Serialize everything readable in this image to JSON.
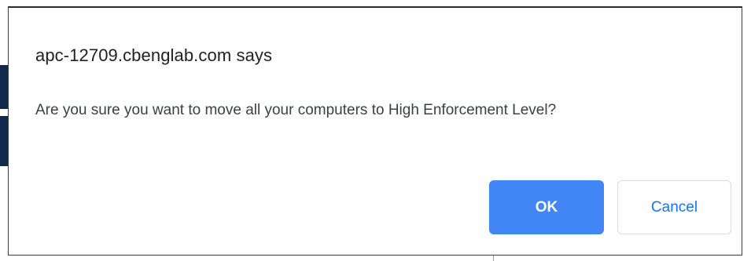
{
  "dialog": {
    "title": "apc-12709.cbenglab.com says",
    "message": "Are you sure you want to move all your computers to High Enforcement Level?",
    "ok_label": "OK",
    "cancel_label": "Cancel"
  },
  "colors": {
    "ok_button_bg": "#4285f4",
    "cancel_text": "#1a73e8",
    "title_text": "#202124",
    "message_text": "#3c4043"
  }
}
